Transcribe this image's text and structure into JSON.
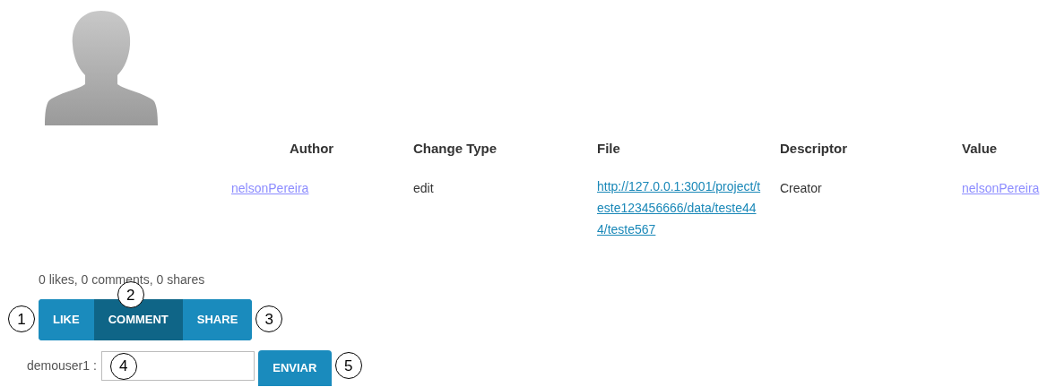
{
  "table": {
    "columns": [
      "Author",
      "Change Type",
      "File",
      "Descriptor",
      "Value"
    ],
    "rows": [
      {
        "author": "nelsonPereira",
        "change_type": "edit",
        "file": "http://127.0.0.1:3001/project/teste123456666/data/teste444/teste567",
        "descriptor": "Creator",
        "value": "nelsonPereira"
      }
    ]
  },
  "summary": "0 likes, 0 comments, 0 shares",
  "actions": [
    {
      "label": "LIKE",
      "selected": false,
      "callout": "1"
    },
    {
      "label": "COMMENT",
      "selected": true,
      "callout": "2"
    },
    {
      "label": "SHARE",
      "selected": false,
      "callout": "3"
    }
  ],
  "comment": {
    "user": "demouser1 :",
    "callout": "4"
  },
  "send": {
    "label": "ENVIAR",
    "callout": "5"
  }
}
